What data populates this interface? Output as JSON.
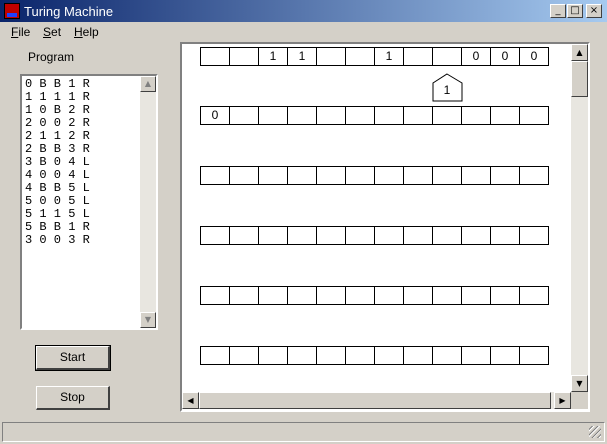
{
  "window": {
    "title": "Turing Machine",
    "controls": {
      "minimize": "_",
      "maximize": "□",
      "close": "×"
    }
  },
  "menu": [
    {
      "label": "File",
      "accel": "F",
      "rest": "ile"
    },
    {
      "label": "Set",
      "accel": "S",
      "rest": "et"
    },
    {
      "label": "Help",
      "accel": "H",
      "rest": "elp"
    }
  ],
  "program": {
    "label": "Program",
    "lines": [
      "0 B B 1 R",
      "1 1 1 1 R",
      "1 0 B 2 R",
      "2 0 0 2 R",
      "2 1 1 2 R",
      "2 B B 3 R",
      "3 B 0 4 L",
      "4 0 0 4 L",
      "4 B B 5 L",
      "5 0 0 5 L",
      "5 1 1 5 L",
      "5 B B 1 R",
      "3 0 0 3 R"
    ]
  },
  "buttons": {
    "start": "Start",
    "stop": "Stop"
  },
  "tape_rows": [
    [
      "",
      "",
      "1",
      "1",
      "",
      "",
      "1",
      "",
      "",
      "0",
      "0",
      "0"
    ],
    [
      "0",
      "",
      "",
      "",
      "",
      "",
      "",
      "",
      "",
      "",
      "",
      ""
    ],
    [
      "",
      "",
      "",
      "",
      "",
      "",
      "",
      "",
      "",
      "",
      "",
      ""
    ],
    [
      "",
      "",
      "",
      "",
      "",
      "",
      "",
      "",
      "",
      "",
      "",
      ""
    ],
    [
      "",
      "",
      "",
      "",
      "",
      "",
      "",
      "",
      "",
      "",
      "",
      ""
    ],
    [
      "",
      "",
      "",
      "",
      "",
      "",
      "",
      "",
      "",
      "",
      "",
      ""
    ]
  ],
  "head": {
    "state": "1",
    "cell_index": 8,
    "row": 0
  },
  "scroll_glyphs": {
    "up": "▲",
    "down": "▼",
    "left": "◀",
    "right": "▶"
  }
}
